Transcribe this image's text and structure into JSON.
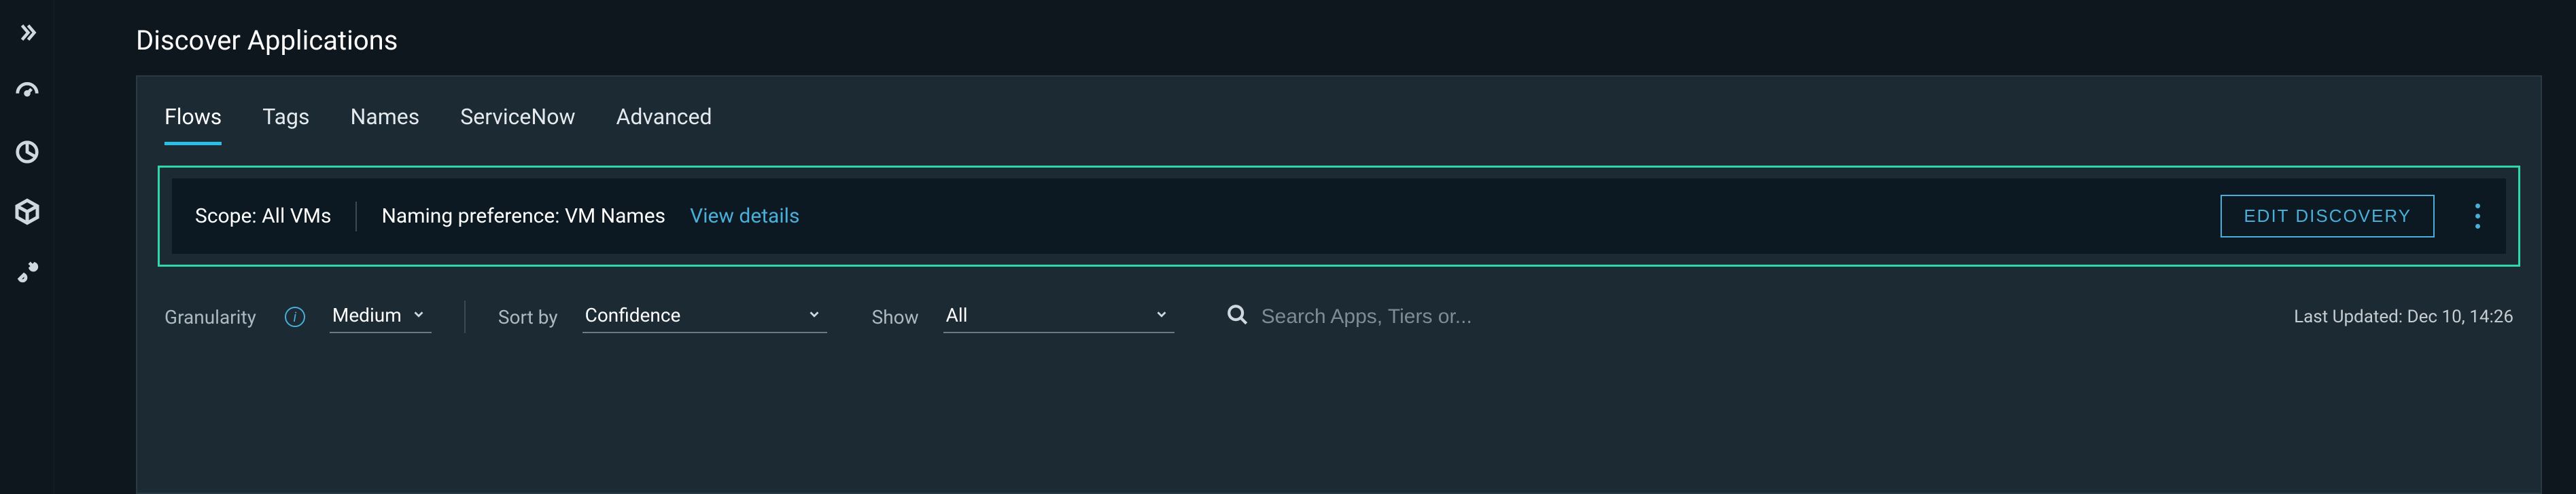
{
  "page": {
    "title": "Discover Applications"
  },
  "tabs": [
    {
      "label": "Flows",
      "active": true
    },
    {
      "label": "Tags",
      "active": false
    },
    {
      "label": "Names",
      "active": false
    },
    {
      "label": "ServiceNow",
      "active": false
    },
    {
      "label": "Advanced",
      "active": false
    }
  ],
  "scope": {
    "scope_label": "Scope: All VMs",
    "naming_label": "Naming preference: VM Names",
    "view_details": "View details",
    "edit_button": "EDIT DISCOVERY"
  },
  "controls": {
    "granularity_label": "Granularity",
    "granularity_value": "Medium",
    "sortby_label": "Sort by",
    "sortby_value": "Confidence",
    "show_label": "Show",
    "show_value": "All",
    "search_placeholder": "Search Apps, Tiers or...",
    "last_updated": "Last Updated: Dec 10, 14:26"
  }
}
